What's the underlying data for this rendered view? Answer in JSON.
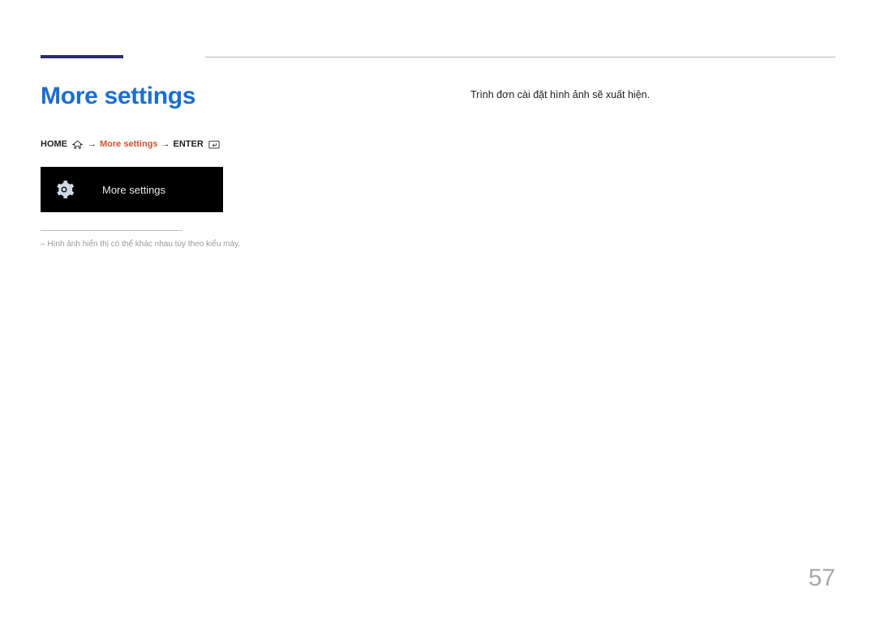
{
  "page": {
    "title": "More settings",
    "rightText": "Trình đơn cài đặt hình ảnh sẽ xuất hiện.",
    "pageNumber": "57"
  },
  "breadcrumb": {
    "home": "HOME",
    "arrow": "→",
    "moreSettings": "More settings",
    "enter": "ENTER"
  },
  "panel": {
    "label": "More settings"
  },
  "footnote": {
    "dash": "–",
    "text": "Hình ảnh hiển thị có thể khác nhau tùy theo kiểu máy."
  }
}
